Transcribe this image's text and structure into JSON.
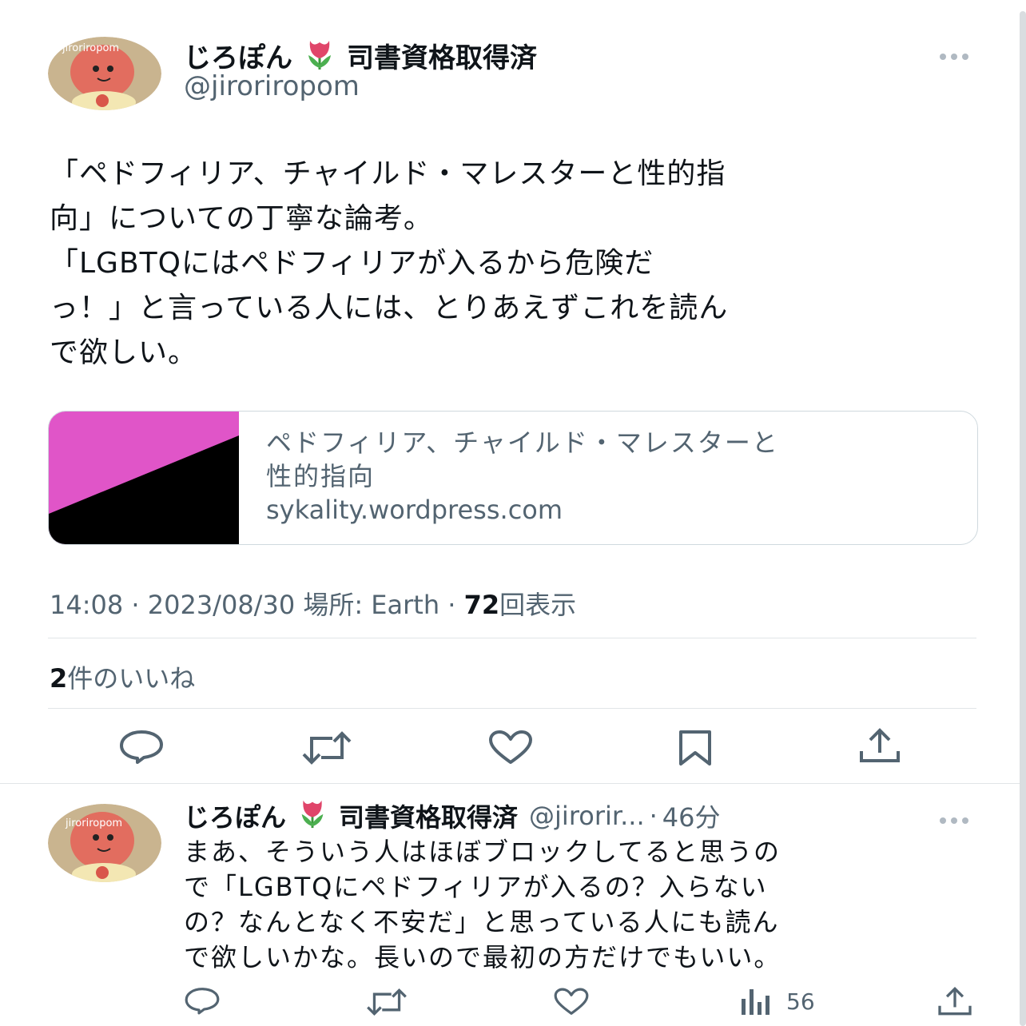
{
  "main_tweet": {
    "display_name": "じろぽん",
    "name_suffix": "司書資格取得済",
    "handle": "@jiroriropom",
    "avatar_text": "jiroriropom",
    "text_lines": [
      "「ペドフィリア、チャイルド・マレスターと性的指",
      "向」についての丁寧な論考。",
      "「LGBTQにはペドフィリアが入るから危険だ",
      "っ！」と言っている人には、とりあえずこれを読ん",
      "で欲しい。"
    ],
    "card": {
      "title_lines": [
        "ペドフィリア、チャイルド・マレスターと",
        "性的指向"
      ],
      "domain": "sykality.wordpress.com",
      "thumb_colors": {
        "top": "#e055c8",
        "bottom": "#000000"
      }
    },
    "meta": {
      "time": "14:08",
      "sep1": "·",
      "date": "2023/08/30",
      "location_label": "場所: Earth",
      "sep2": "·",
      "views": "72",
      "views_label": "回表示"
    },
    "likes": {
      "count": "2",
      "label": "件のいいね"
    },
    "actions": [
      "reply-icon",
      "retweet-icon",
      "like-icon",
      "bookmark-icon",
      "share-icon"
    ]
  },
  "reply": {
    "display_name": "じろぽん",
    "name_suffix": "司書資格取得済",
    "handle": "@jirorir...",
    "sep": "·",
    "time_ago": "46分",
    "avatar_text": "jiroriropom",
    "text_lines": [
      "まあ、そういう人はほぼブロックしてると思うの",
      "で「LGBTQにペドフィリアが入るの？入らない",
      "の？なんとなく不安だ」と思っている人にも読ん",
      "で欲しいかな。長いので最初の方だけでもいい。"
    ],
    "views": "56"
  },
  "colors": {
    "text": "#0f1419",
    "muted": "#536471",
    "border": "#cfd9de",
    "accent": "#1d9bf0"
  }
}
